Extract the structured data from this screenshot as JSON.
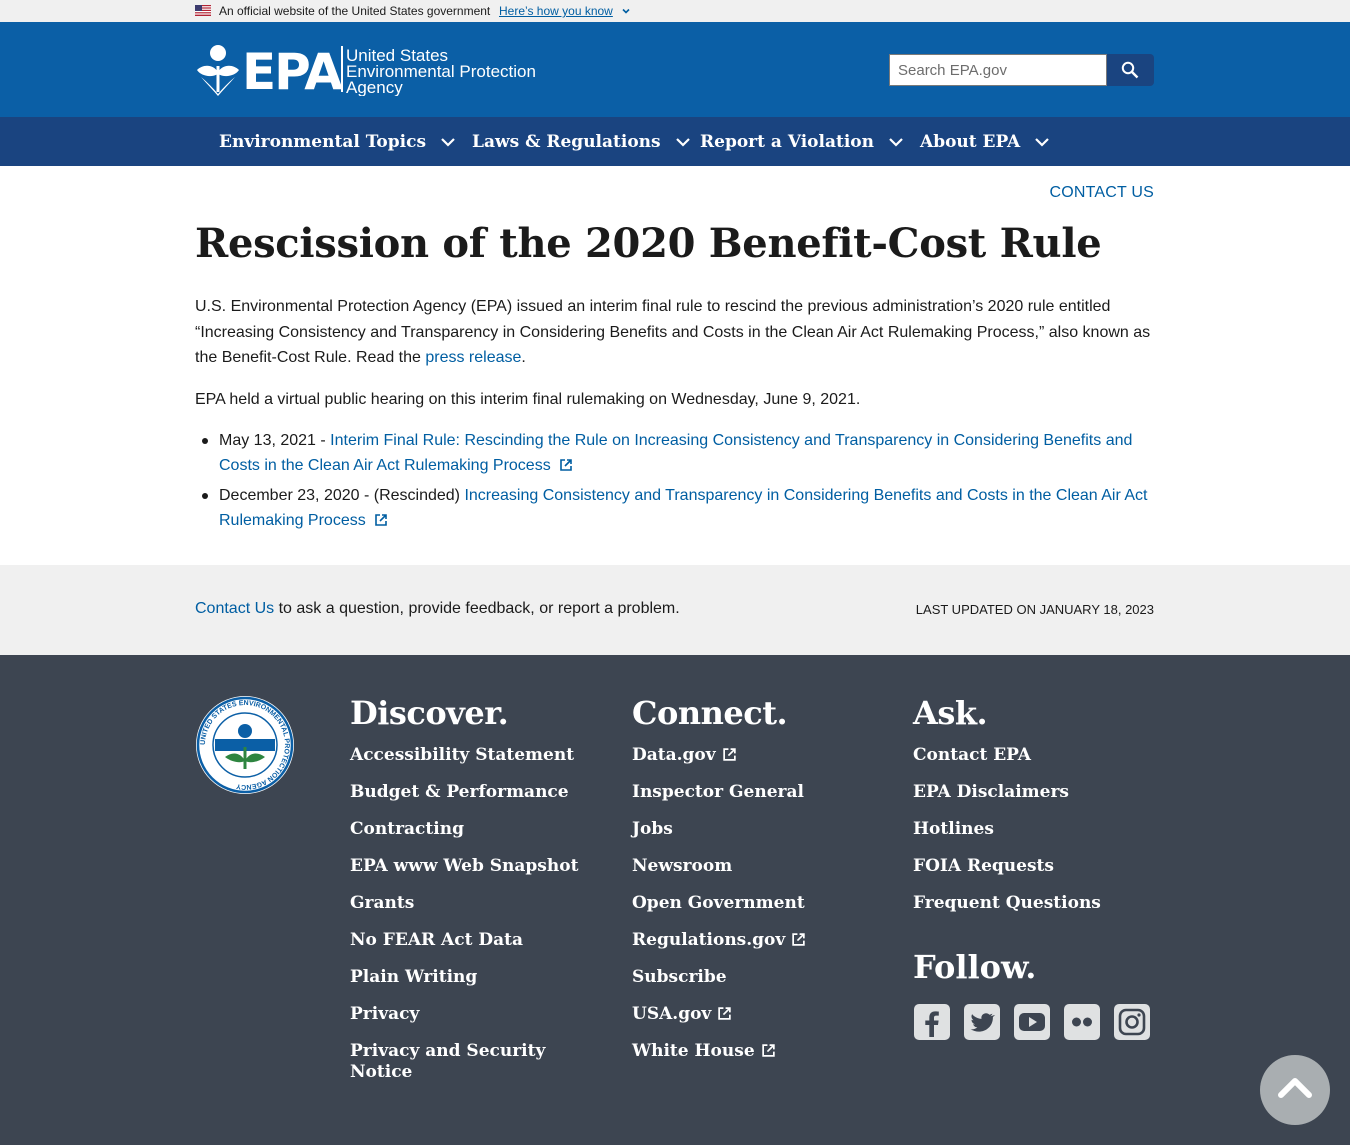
{
  "gov_banner": {
    "official_text": "An official website of the United States government",
    "how_link": "Here’s how you know"
  },
  "header": {
    "logo_text": "EPA",
    "agency_line1": "United States",
    "agency_line2": "Environmental Protection",
    "agency_line3": "Agency",
    "search_placeholder": "Search EPA.gov"
  },
  "nav": {
    "items": [
      {
        "label": "Environmental Topics"
      },
      {
        "label": "Laws & Regulations"
      },
      {
        "label": "Report a Violation"
      },
      {
        "label": "About EPA"
      }
    ]
  },
  "page": {
    "contact_us_label": "CONTACT US",
    "title": "Rescission of the 2020 Benefit-Cost Rule",
    "intro_text": "U.S. Environmental Protection Agency (EPA) issued an interim final rule to rescind the previous administration’s 2020 rule entitled “Increasing Consistency and Transparency in Considering Benefits and Costs in the Clean Air Act Rulemaking Process,” also known as the Benefit-Cost Rule. Read the ",
    "press_release_link": "press release",
    "intro_end": ".",
    "hearing_text": "EPA held a virtual public hearing on this interim final rulemaking on Wednesday, June 9, 2021.",
    "items": [
      {
        "prefix": "May 13, 2021 - ",
        "link": "Interim Final Rule:  Rescinding the Rule on Increasing Consistency and Transparency in Considering Benefits and Costs in the Clean Air Act Rulemaking Process"
      },
      {
        "prefix": "December 23, 2020 - (Rescinded) ",
        "link": "Increasing Consistency and Transparency in Considering Benefits and Costs in the Clean Air Act Rulemaking Process"
      }
    ]
  },
  "feedback": {
    "contact_link": "Contact Us",
    "text": " to ask a question, provide feedback, or report a problem.",
    "last_updated": "LAST UPDATED ON JANUARY 18, 2023"
  },
  "footer": {
    "seal_text": "UNITED STATES ENVIRONMENTAL PROTECTION AGENCY",
    "discover": {
      "title": "Discover.",
      "links": [
        "Accessibility Statement",
        "Budget & Performance",
        "Contracting",
        "EPA www Web Snapshot",
        "Grants",
        "No FEAR Act Data",
        "Plain Writing",
        "Privacy",
        "Privacy and Security Notice"
      ]
    },
    "connect": {
      "title": "Connect.",
      "links": [
        {
          "label": "Data.gov",
          "external": true
        },
        {
          "label": "Inspector General",
          "external": false
        },
        {
          "label": "Jobs",
          "external": false
        },
        {
          "label": "Newsroom",
          "external": false
        },
        {
          "label": "Open Government",
          "external": false
        },
        {
          "label": "Regulations.gov",
          "external": true
        },
        {
          "label": "Subscribe",
          "external": false
        },
        {
          "label": "USA.gov",
          "external": true
        },
        {
          "label": "White House",
          "external": true
        }
      ]
    },
    "ask": {
      "title": "Ask.",
      "links": [
        "Contact EPA",
        "EPA Disclaimers",
        "Hotlines",
        "FOIA Requests",
        "Frequent Questions"
      ]
    },
    "follow": {
      "title": "Follow.",
      "icons": [
        "facebook-icon",
        "twitter-icon",
        "youtube-icon",
        "flickr-icon",
        "instagram-icon"
      ]
    }
  },
  "colors": {
    "header_blue": "#0b5fa6",
    "nav_blue": "#1a4480",
    "link_blue": "#005ea2",
    "footer_gray": "#3d4551",
    "band_gray": "#f0f0f0"
  }
}
